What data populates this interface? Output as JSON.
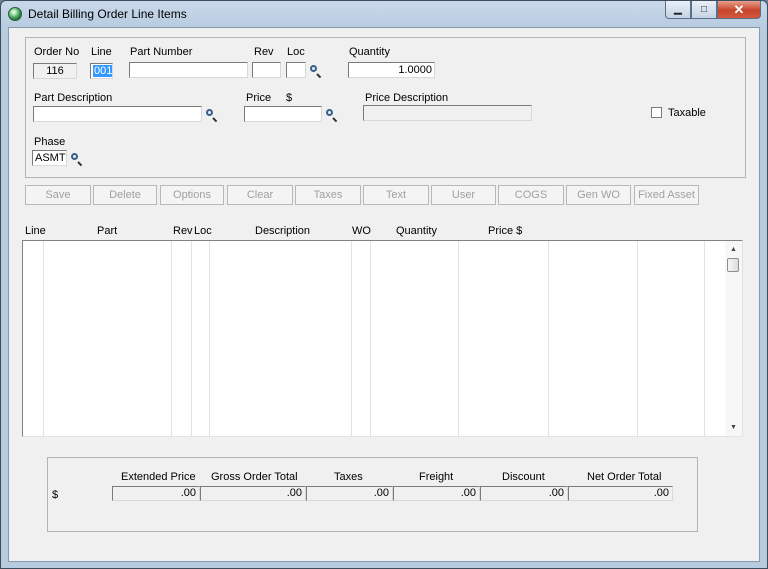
{
  "window": {
    "title": "Detail Billing Order Line Items",
    "min_glyph": "▁",
    "max_glyph": "□",
    "close_glyph": "✕"
  },
  "header": {
    "order_no": {
      "label": "Order No",
      "value": "116"
    },
    "line": {
      "label": "Line",
      "value": "001"
    },
    "part_number": {
      "label": "Part Number",
      "value": ""
    },
    "rev": {
      "label": "Rev",
      "value": ""
    },
    "loc": {
      "label": "Loc",
      "value": ""
    },
    "quantity": {
      "label": "Quantity",
      "value": "1.0000"
    },
    "part_description": {
      "label": "Part Description",
      "value": ""
    },
    "price": {
      "label": "Price",
      "currency": "$",
      "value": ""
    },
    "price_description": {
      "label": "Price Description",
      "value": ""
    },
    "taxable": {
      "label": "Taxable",
      "checked": false
    },
    "phase": {
      "label": "Phase",
      "value": "ASMT"
    }
  },
  "buttons": [
    "Save",
    "Delete",
    "Options",
    "Clear",
    "Taxes",
    "Text",
    "User",
    "COGS",
    "Gen WO",
    "Fixed Asset"
  ],
  "grid": {
    "columns": [
      "Line",
      "Part",
      "Rev",
      "Loc",
      "Description",
      "WO",
      "Quantity",
      "Price $"
    ],
    "rows": [],
    "scroll_up": "▲",
    "scroll_down": "▼"
  },
  "totals": {
    "currency": "$",
    "columns": [
      {
        "label": "Extended Price",
        "value": ".00"
      },
      {
        "label": "Gross Order Total",
        "value": ".00"
      },
      {
        "label": "Taxes",
        "value": ".00"
      },
      {
        "label": "Freight",
        "value": ".00"
      },
      {
        "label": "Discount",
        "value": ".00"
      },
      {
        "label": "Net Order Total",
        "value": ".00"
      }
    ]
  }
}
